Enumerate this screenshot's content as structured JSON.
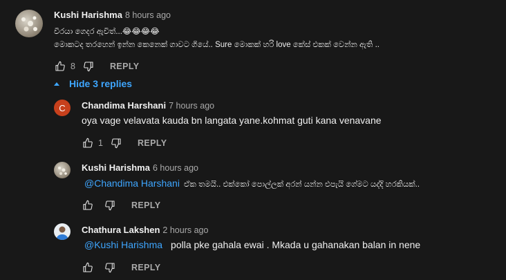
{
  "colors": {
    "background": "#181818",
    "link": "#3ea6ff",
    "muted": "#aaaaaa",
    "avatar_c": "#c7401c"
  },
  "comment": {
    "author": "Kushi Harishma",
    "time": "8 hours ago",
    "line1": "වීරයා ගෙදර ඇවිත්...😂😂😂😂",
    "line2": "මොකටද තරහෙන් ඉන්න කෙනෙක් ගාවට ගියේ.. Sure මොකක් හරි love කේස් එකක් වෙන්න ඇති ..",
    "likes": "8",
    "reply_label": "REPLY"
  },
  "hide_replies_label": "Hide 3 replies",
  "replies": [
    {
      "author": "Chandima Harshani",
      "time": "7 hours ago",
      "avatar_letter": "C",
      "text": "oya vage velavata kauda bn langata yane.kohmat guti kana venavane",
      "likes": "1",
      "reply_label": "REPLY"
    },
    {
      "author": "Kushi Harishma",
      "time": "6 hours ago",
      "mention": "@Chandima Harshani",
      "text": "ඒක තමයි.. එක්කෝ පොල්ලක් අරන් යන්න එපැයි ගේමට යද්දි හරකියක්..",
      "reply_label": "REPLY"
    },
    {
      "author": "Chathura Lakshen",
      "time": "2 hours ago",
      "mention": "@Kushi Harishma",
      "text": "polla pke gahala ewai . Mkada u gahanakan balan in nene",
      "reply_label": "REPLY"
    }
  ]
}
